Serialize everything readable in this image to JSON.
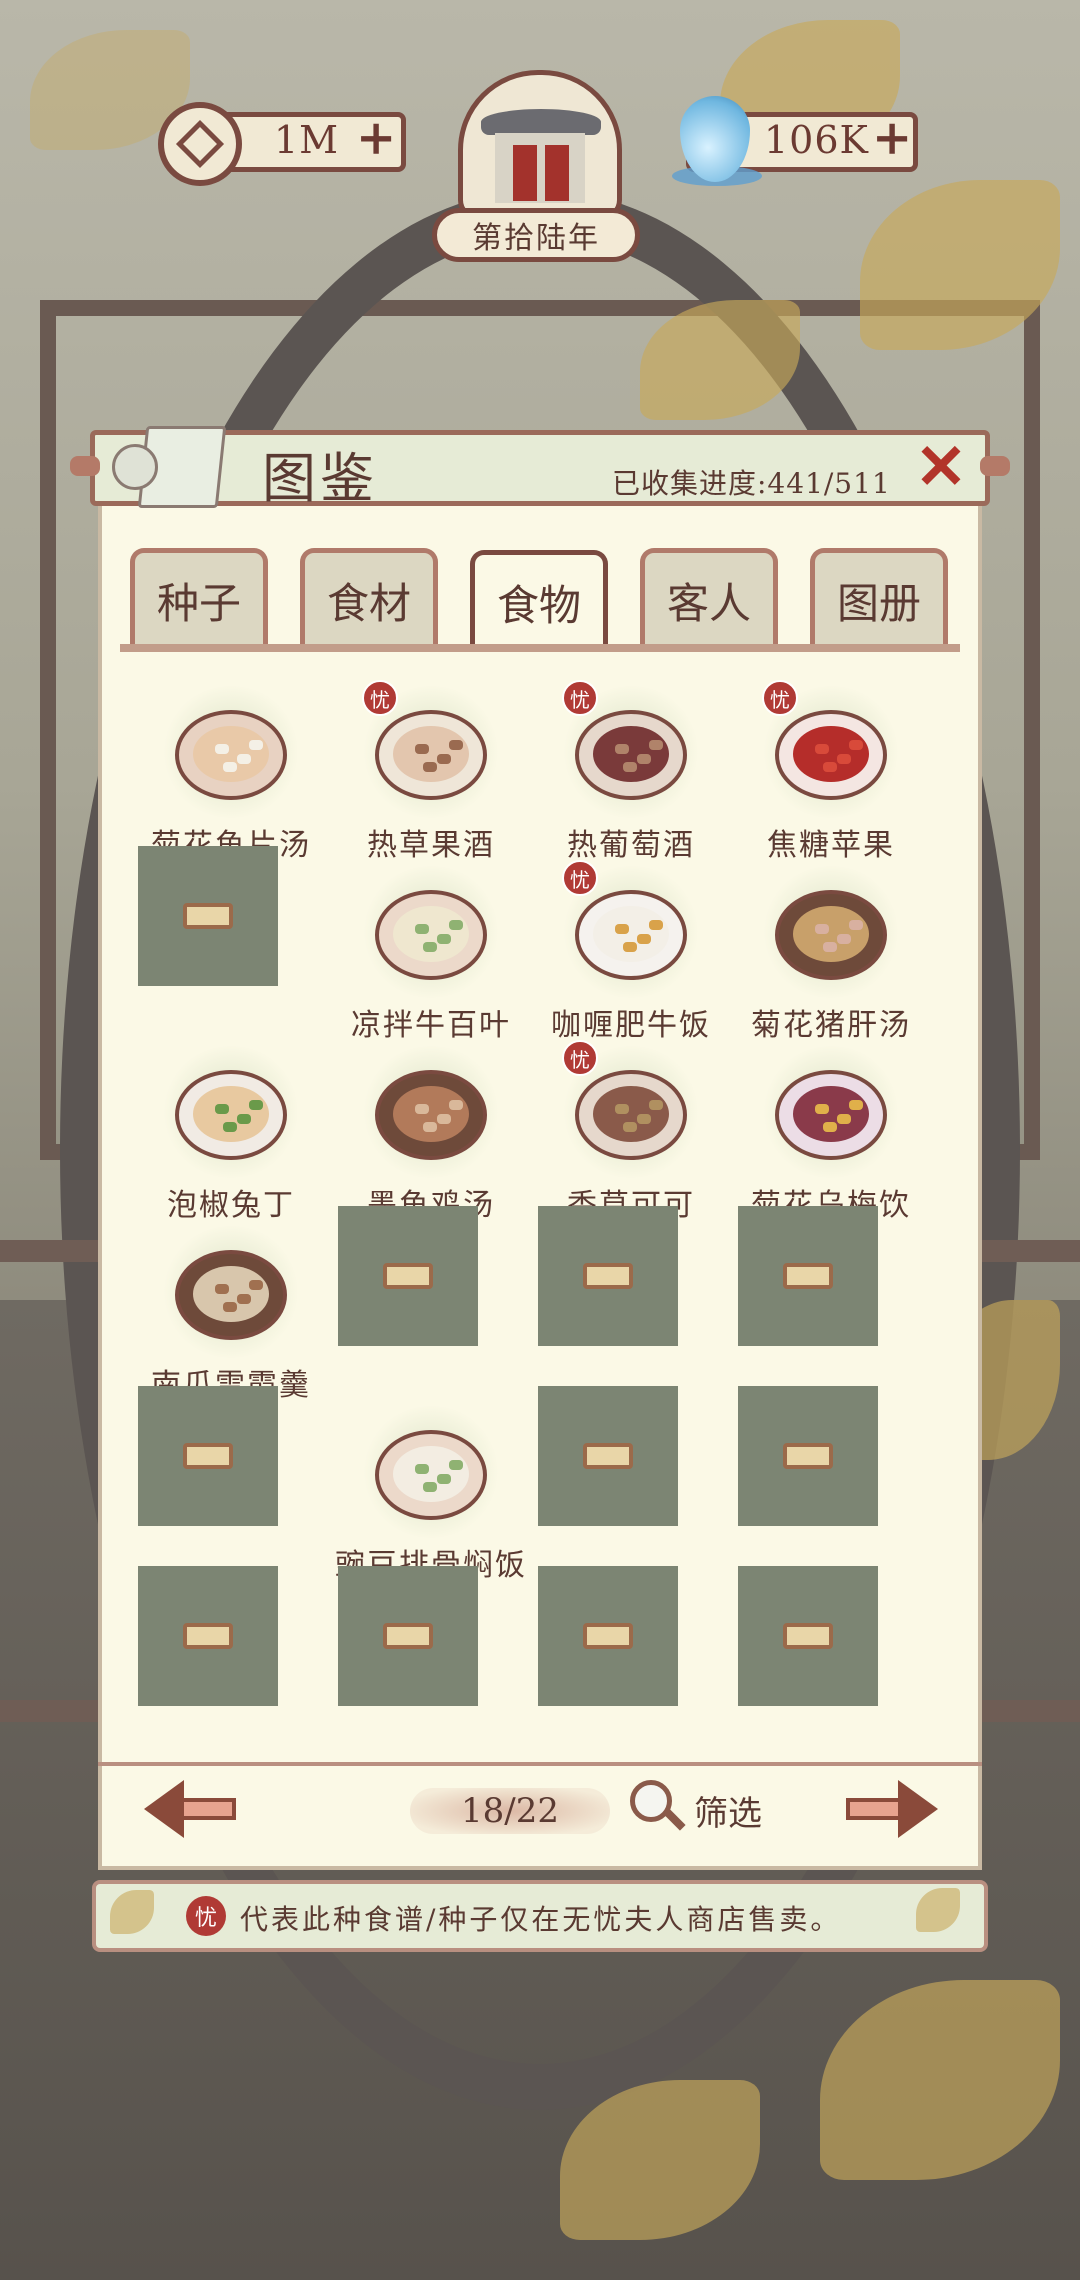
{
  "hud": {
    "coins": "1M",
    "water": "106K",
    "year": "第拾陆年",
    "coin_icon": "coin-icon",
    "water_icon": "water-drop-icon"
  },
  "panel": {
    "title": "图鉴",
    "progress": "已收集进度:441/511",
    "close_icon": "close-icon"
  },
  "tabs": [
    {
      "label": "种子",
      "active": false
    },
    {
      "label": "食材",
      "active": false
    },
    {
      "label": "食物",
      "active": true
    },
    {
      "label": "客人",
      "active": false
    },
    {
      "label": "图册",
      "active": false
    }
  ],
  "grid": [
    {
      "name": "菊花鱼片汤",
      "unlocked": true,
      "badge": false,
      "plate": "#e8d2c2",
      "food": "#e9c9a8",
      "fleck": "#f4f0e6"
    },
    {
      "name": "热草果酒",
      "unlocked": true,
      "badge": true,
      "plate": "#efe6d8",
      "food": "#e3c6ae",
      "fleck": "#9a6a50"
    },
    {
      "name": "热葡萄酒",
      "unlocked": true,
      "badge": true,
      "plate": "#e6d8cc",
      "food": "#7a3a3a",
      "fleck": "#b0836a"
    },
    {
      "name": "焦糖苹果",
      "unlocked": true,
      "badge": true,
      "plate": "#f4e6e2",
      "food": "#b52d2a",
      "fleck": "#d84a3a"
    },
    {
      "name": "",
      "unlocked": false,
      "badge": false
    },
    {
      "name": "凉拌牛百叶",
      "unlocked": true,
      "badge": false,
      "plate": "#ecd9ca",
      "food": "#efe7cf",
      "fleck": "#8fb272"
    },
    {
      "name": "咖喱肥牛饭",
      "unlocked": true,
      "badge": true,
      "plate": "#f5f2ee",
      "food": "#f3efe7",
      "fleck": "#d9a24a"
    },
    {
      "name": "菊花猪肝汤",
      "unlocked": true,
      "badge": false,
      "plate": "#6e4a3a",
      "food": "#c8a06a",
      "fleck": "#d8b0a0"
    },
    {
      "name": "泡椒兔丁",
      "unlocked": true,
      "badge": false,
      "plate": "#f1ebe4",
      "food": "#e8c9a0",
      "fleck": "#6a9a4a"
    },
    {
      "name": "墨鱼鸡汤",
      "unlocked": true,
      "badge": false,
      "plate": "#6e4a3a",
      "food": "#b27a5a",
      "fleck": "#d9b89a"
    },
    {
      "name": "香草可可",
      "unlocked": true,
      "badge": true,
      "plate": "#e6d8cc",
      "food": "#8a5a4a",
      "fleck": "#b09060"
    },
    {
      "name": "菊花乌梅饮",
      "unlocked": true,
      "badge": false,
      "plate": "#ecdde6",
      "food": "#8a3a4a",
      "fleck": "#e0b04a"
    },
    {
      "name": "南瓜雪霞羹",
      "unlocked": true,
      "badge": false,
      "plate": "#6e4a3a",
      "food": "#d8c6ac",
      "fleck": "#a07050"
    },
    {
      "name": "",
      "unlocked": false,
      "badge": false
    },
    {
      "name": "",
      "unlocked": false,
      "badge": false
    },
    {
      "name": "",
      "unlocked": false,
      "badge": false
    },
    {
      "name": "",
      "unlocked": false,
      "badge": false
    },
    {
      "name": "豌豆排骨焖饭",
      "unlocked": true,
      "badge": false,
      "plate": "#ecd9ca",
      "food": "#f3ede2",
      "fleck": "#8fb272"
    },
    {
      "name": "",
      "unlocked": false,
      "badge": false
    },
    {
      "name": "",
      "unlocked": false,
      "badge": false
    },
    {
      "name": "",
      "unlocked": false,
      "badge": false
    },
    {
      "name": "",
      "unlocked": false,
      "badge": false
    },
    {
      "name": "",
      "unlocked": false,
      "badge": false
    },
    {
      "name": "",
      "unlocked": false,
      "badge": false
    }
  ],
  "badge_text": "忧",
  "pager": {
    "page": "18/22",
    "filter_label": "筛选",
    "prev_icon": "arrow-left-icon",
    "next_icon": "arrow-right-icon",
    "filter_icon": "magnifier-icon"
  },
  "note": {
    "badge": "忧",
    "text": "代表此种食谱/种子仅在无忧夫人商店售卖。"
  },
  "colors": {
    "accent": "#7a4a40",
    "panel_bg": "#fbf9e6",
    "badge_red": "#b03a35",
    "locked_bg": "#7c8573"
  }
}
